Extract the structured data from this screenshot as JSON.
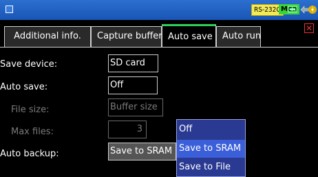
{
  "titlebar": {
    "rs_label": "RS-232C",
    "mon_label": "Mon",
    "icons": [
      "window-icon",
      "network-icon",
      "keyboard-icon",
      "memory-card-icon",
      "power-icon"
    ]
  },
  "tabs": [
    {
      "label": "Additional info."
    },
    {
      "label": "Capture buffer"
    },
    {
      "label": "Auto save",
      "active": true
    },
    {
      "label": "Auto run"
    }
  ],
  "form": {
    "save_device": {
      "label": "Save device:",
      "value": "SD card"
    },
    "auto_save": {
      "label": "Auto save:",
      "value": "Off"
    },
    "file_size": {
      "label": "File size:",
      "value": "Buffer size"
    },
    "max_files": {
      "label": "Max files:",
      "value": "3"
    },
    "auto_backup": {
      "label": "Auto backup:",
      "value": "Save to SRAM"
    }
  },
  "dropdown": {
    "options": [
      "Off",
      "Save to SRAM",
      "Save to File"
    ],
    "selected": "Save to SRAM"
  },
  "colors": {
    "titlebar": "#1f5fc4",
    "active_tab_accent": "#2fcf57",
    "dropdown_bg": "#2a3a93",
    "dropdown_selected": "#3b5fd9",
    "mon_badge": "#3ad33a",
    "rs_badge": "#f3ea5a",
    "close": "#ee3333"
  }
}
